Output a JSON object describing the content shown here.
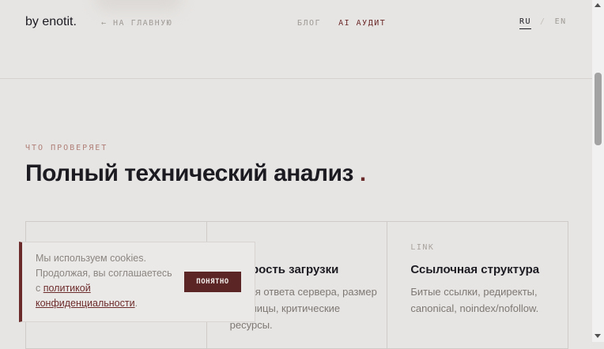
{
  "header": {
    "logo": "by enotit",
    "logo_dot": ".",
    "home_link": "← НА ГЛАВНУЮ",
    "nav": [
      {
        "label": "БЛОГ",
        "active": false
      },
      {
        "label": "AI АУДИТ",
        "active": true
      }
    ],
    "lang": {
      "ru": "RU",
      "sep": "/",
      "en": "EN",
      "active": "RU"
    }
  },
  "section": {
    "eyebrow": "ЧТО ПРОВЕРЯЕТ",
    "title": "Полный технический анализ",
    "title_dot": "."
  },
  "cards": [
    {
      "code": "",
      "title": "",
      "desc": ""
    },
    {
      "code": "",
      "title": "Скорость загрузки",
      "desc": "Время ответа сервера, размер страницы, критические ресурсы."
    },
    {
      "code": "LINK",
      "title": "Ссылочная структура",
      "desc": "Битые ссылки, редиректы, canonical, noindex/nofollow."
    }
  ],
  "cookie": {
    "text_before": "Мы используем cookies. Продолжая, вы соглашаетесь с ",
    "link": "политикой конфиденциальности",
    "text_after": ".",
    "button": "ПОНЯТНО"
  },
  "colors": {
    "background": "#e7e5e3",
    "accent": "#6c2b2b",
    "button": "#5b2526",
    "text": "#1c1b22",
    "muted": "#7d7874"
  }
}
